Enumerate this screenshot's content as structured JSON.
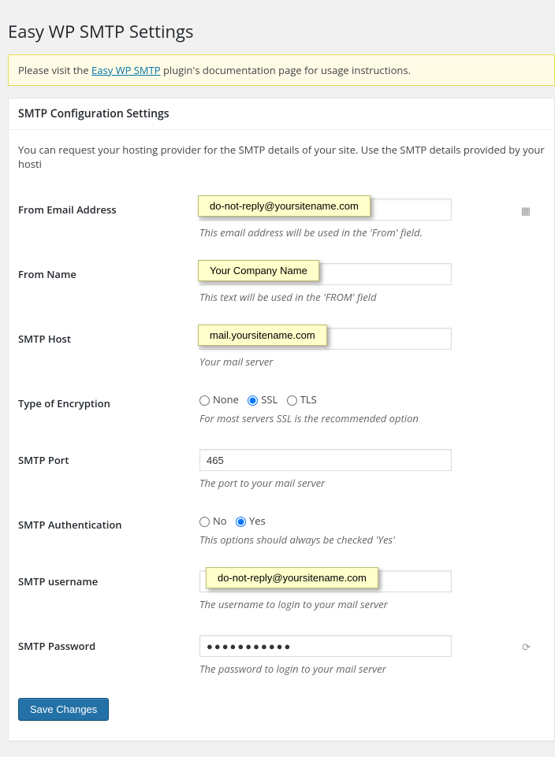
{
  "page_title": "Easy WP SMTP Settings",
  "notice": {
    "pre": "Please visit the ",
    "link": "Easy WP SMTP",
    "post": " plugin's documentation page for usage instructions."
  },
  "section_title": "SMTP Configuration Settings",
  "section_desc": "You can request your hosting provider for the SMTP details of your site. Use the SMTP details provided by your hosti",
  "fields": {
    "from_email": {
      "label": "From Email Address",
      "value": "",
      "hint": "do-not-reply@yoursitename.com",
      "desc": "This email address will be used in the 'From' field."
    },
    "from_name": {
      "label": "From Name",
      "value": "",
      "hint": "Your Company Name",
      "desc": "This text will be used in the 'FROM' field"
    },
    "smtp_host": {
      "label": "SMTP Host",
      "value": "",
      "hint": "mail.yoursitename.com",
      "desc": "Your mail server"
    },
    "encryption": {
      "label": "Type of Encryption",
      "options": [
        "None",
        "SSL",
        "TLS"
      ],
      "selected": "SSL",
      "desc": "For most servers SSL is the recommended option"
    },
    "smtp_port": {
      "label": "SMTP Port",
      "value": "465",
      "desc": "The port to your mail server"
    },
    "smtp_auth": {
      "label": "SMTP Authentication",
      "options": [
        "No",
        "Yes"
      ],
      "selected": "Yes",
      "desc": "This options should always be checked 'Yes'"
    },
    "smtp_user": {
      "label": "SMTP username",
      "value": "",
      "hint": "do-not-reply@yoursitename.com",
      "desc": "The username to login to your mail server"
    },
    "smtp_pass": {
      "label": "SMTP Password",
      "value": "●●●●●●●●●●●",
      "desc": "The password to login to your mail server"
    }
  },
  "save_label": "Save Changes"
}
